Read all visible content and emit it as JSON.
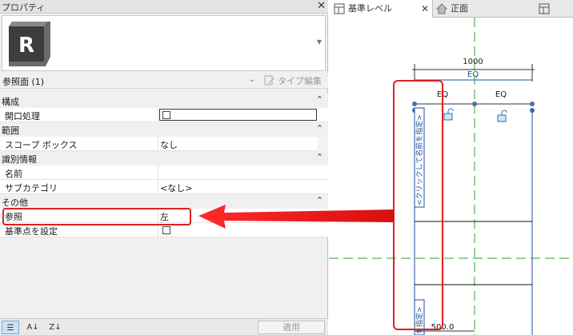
{
  "properties": {
    "title": "プロパティ",
    "type_dropdown_arrow": "▼",
    "instance_label": "参照面 (1)",
    "type_edit_label": "タイプ編集",
    "sections": [
      {
        "label": "構成",
        "rows": [
          {
            "name": "開口処理",
            "kind": "textbox-checkbox"
          }
        ]
      },
      {
        "label": "範囲",
        "rows": [
          {
            "name": "スコープ ボックス",
            "value": "なし",
            "kind": "text"
          }
        ]
      },
      {
        "label": "識別情報",
        "rows": [
          {
            "name": "名前",
            "value": "",
            "kind": "text"
          },
          {
            "name": "サブカテゴリ",
            "value": "<なし>",
            "kind": "text"
          }
        ]
      },
      {
        "label": "その他",
        "rows": [
          {
            "name": "参照",
            "value": "左",
            "kind": "text"
          },
          {
            "name": "基準点を設定",
            "kind": "checkbox"
          }
        ]
      }
    ],
    "section_toggle": "⌃",
    "apply_label": "適用"
  },
  "view": {
    "tabs": [
      {
        "label": "基準レベル",
        "active": true
      },
      {
        "label": "正面",
        "active": false
      },
      {
        "label": "",
        "active": false
      }
    ],
    "dimension_total": "1000",
    "eq_top": "EQ",
    "eq_left": "EQ",
    "eq_right": "EQ",
    "vertical_label_top": "<クリックして名前を指定>",
    "vertical_label_bottom": "を指定>",
    "dimension_bottom": "500.0"
  },
  "colors": {
    "highlight": "#e02020",
    "reference_line": "#2ca02c",
    "dimension_blue": "#1f4e9c"
  }
}
